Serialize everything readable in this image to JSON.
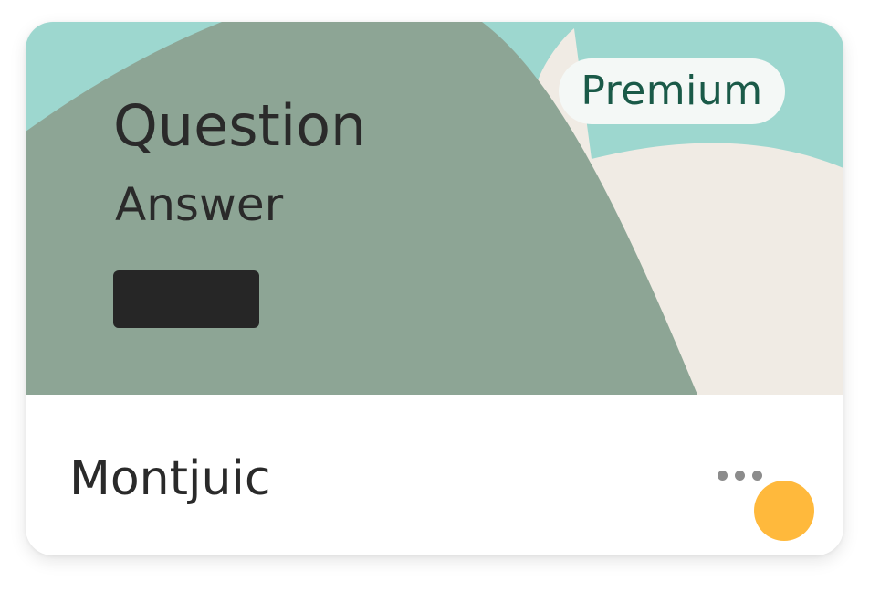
{
  "card": {
    "badge_label": "Premium",
    "thumbnail": {
      "question": "Question",
      "answer": "Answer",
      "colors": {
        "teal": "#9dd7cf",
        "sage": "#8da595",
        "cream": "#f0ebe4",
        "dark_block": "#262626"
      }
    },
    "title": "Montjuic",
    "status_color": "#ffb93c"
  }
}
